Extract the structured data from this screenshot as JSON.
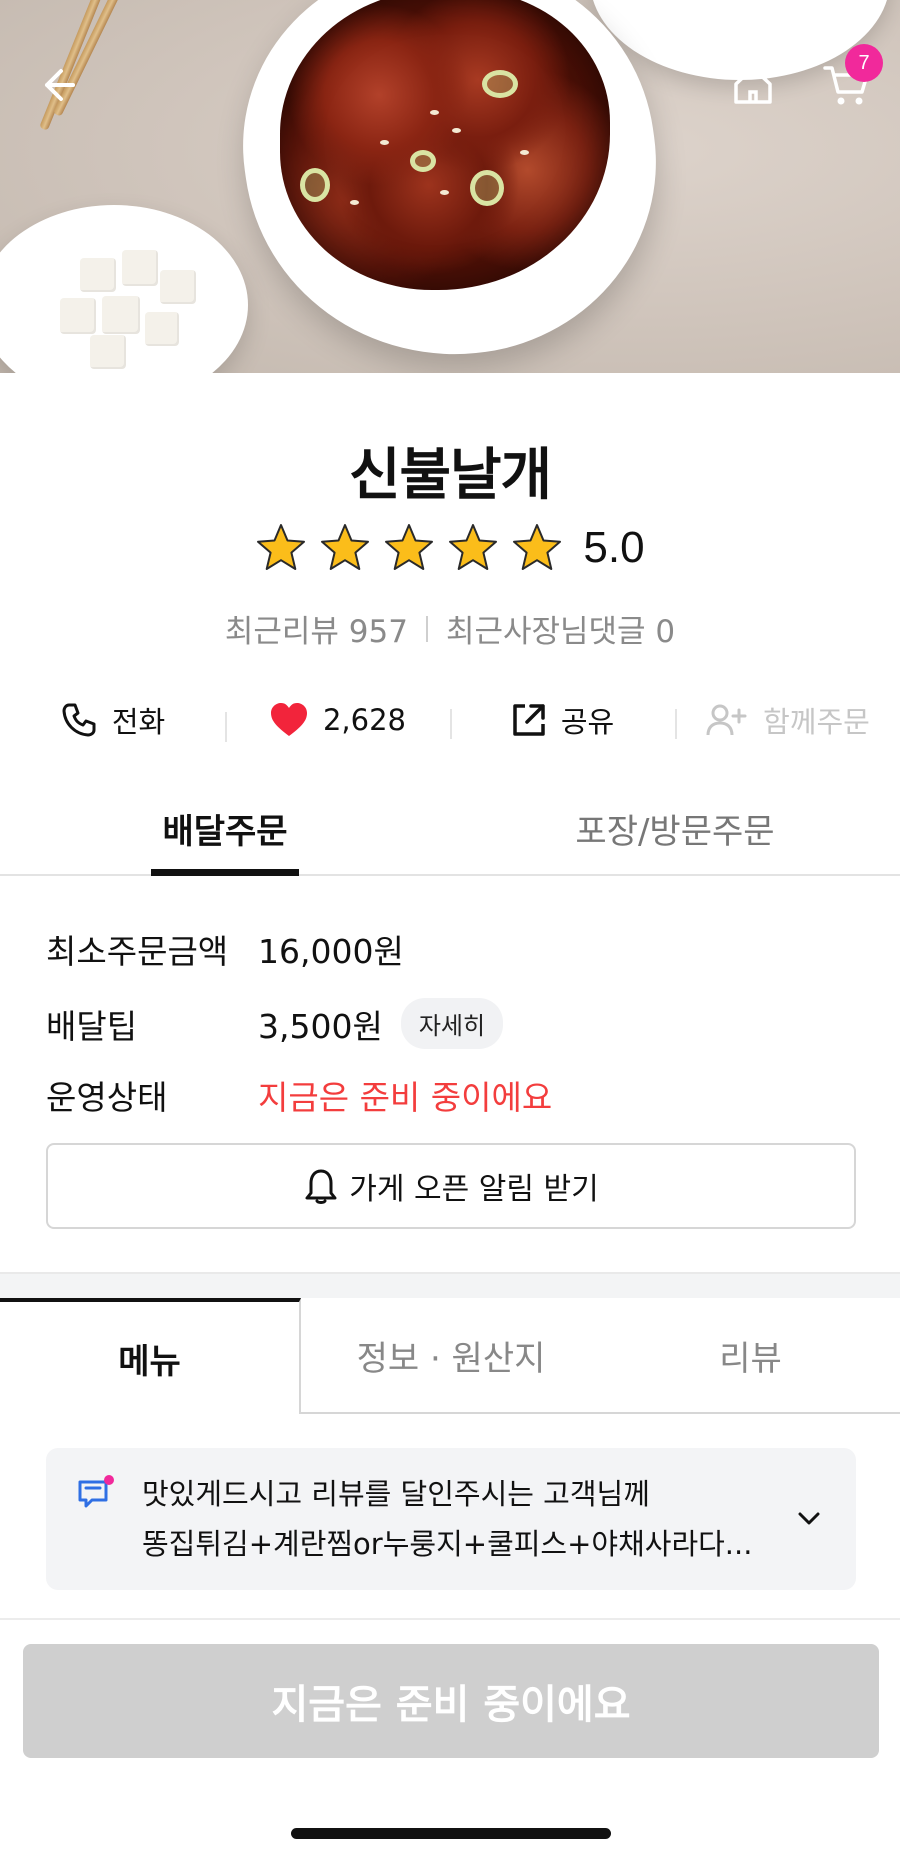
{
  "hero": {
    "cart_count": "7"
  },
  "store": {
    "name": "신불날개",
    "rating": "5.0",
    "stars": 5,
    "review_label": "최근리뷰 957",
    "owner_reply_label": "최근사장님댓글 0"
  },
  "actions": [
    {
      "label": "전화",
      "icon": "phone-icon"
    },
    {
      "label": "2,628",
      "icon": "heart-icon"
    },
    {
      "label": "공유",
      "icon": "share-icon"
    },
    {
      "label": "함께주문",
      "icon": "add-user-icon"
    }
  ],
  "order_tabs": [
    "배달주문",
    "포장/방문주문"
  ],
  "info": {
    "min_order_label": "최소주문금액",
    "min_order_value": "16,000원",
    "delivery_tip_label": "배달팁",
    "delivery_tip_value": "3,500원",
    "detail_label": "자세히",
    "status_label": "운영상태",
    "status_value": "지금은 준비 중이에요"
  },
  "alarm_button": "가게 오픈 알림 받기",
  "menu_tabs": [
    "메뉴",
    "정보 · 원산지",
    "리뷰"
  ],
  "notice": {
    "line1": "맛있게드시고 리뷰를 달인주시는  고객님께",
    "line2": "똥집튀김+계란찜or누룽지+쿨피스+야채사라다..."
  },
  "cta_label": "지금은 준비 중이에요",
  "colors": {
    "badge": "#f1299b",
    "heart": "#f2243b",
    "status_red": "#f33d3d",
    "star": "#fbbd1a",
    "cta_disabled": "#cfcfcf"
  }
}
